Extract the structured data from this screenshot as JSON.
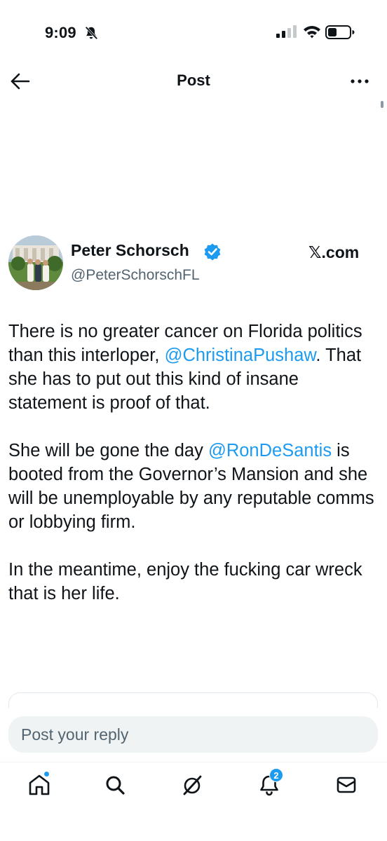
{
  "status_bar": {
    "time": "9:09",
    "icons": [
      "bell-slash-icon",
      "cellular-signal-icon",
      "wifi-icon",
      "battery-icon"
    ]
  },
  "header": {
    "title": "Post",
    "back_icon": "arrow-left-icon",
    "more_icon": "more-horizontal-icon"
  },
  "tweet": {
    "author_name": "Peter Schorsch",
    "verified": true,
    "handle": "@PeterSchorschFL",
    "source_watermark": "𝕏.com",
    "paragraphs": [
      {
        "before": "There is no greater cancer on Florida politics than this interloper, ",
        "mention": "@ChristinaPushaw",
        "after": ". That she has to put out this kind of insane statement is proof of that."
      },
      {
        "before": "She will be gone the day ",
        "mention": "@RonDeSantis",
        "after": " is booted from the Governor’s Mansion and she will be unemployable by any reputable comms or lobbying firm."
      },
      {
        "before": "In the meantime, enjoy the fucking car wreck that is her life.",
        "mention": "",
        "after": ""
      }
    ]
  },
  "reply": {
    "placeholder": "Post your reply",
    "value": ""
  },
  "bottom_nav": {
    "items": [
      {
        "name": "home",
        "icon": "home-icon",
        "has_dot": true
      },
      {
        "name": "search",
        "icon": "search-icon"
      },
      {
        "name": "grok",
        "icon": "grok-icon"
      },
      {
        "name": "notifications",
        "icon": "bell-icon",
        "badge": "2"
      },
      {
        "name": "messages",
        "icon": "envelope-icon"
      }
    ],
    "notifications_badge": "2"
  },
  "colors": {
    "accent": "#1d9bf0",
    "text_primary": "#0f1419",
    "text_secondary": "#536471",
    "input_bg": "#eff3f4"
  }
}
